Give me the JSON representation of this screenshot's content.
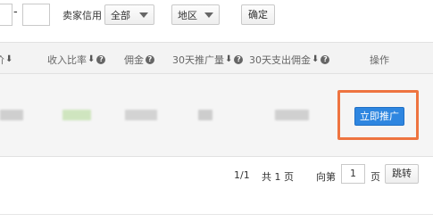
{
  "filters": {
    "range_separator": "-",
    "seller_credit_label": "卖家信用",
    "credit_select": "全部",
    "region_select": "地区",
    "confirm_label": "确定"
  },
  "table": {
    "columns": [
      {
        "label": "价",
        "sortable": true,
        "help": false
      },
      {
        "label": "收入比率",
        "sortable": true,
        "help": true
      },
      {
        "label": "佣金",
        "sortable": false,
        "help": true
      },
      {
        "label": "30天推广量",
        "sortable": true,
        "help": true
      },
      {
        "label": "30天支出佣金",
        "sortable": true,
        "help": true
      },
      {
        "label": "操作",
        "sortable": false,
        "help": false
      }
    ],
    "row": {
      "action_label": "立即推广"
    }
  },
  "pagination": {
    "page_status": "1/1",
    "total_pages": "共 1 页",
    "goto_prefix": "向第",
    "goto_value": "1",
    "goto_suffix": "页",
    "jump_label": "跳转"
  },
  "colors": {
    "primary_button": "#2e86e0",
    "highlight": "#ee7440",
    "header_bg": "#f3f3f3"
  }
}
